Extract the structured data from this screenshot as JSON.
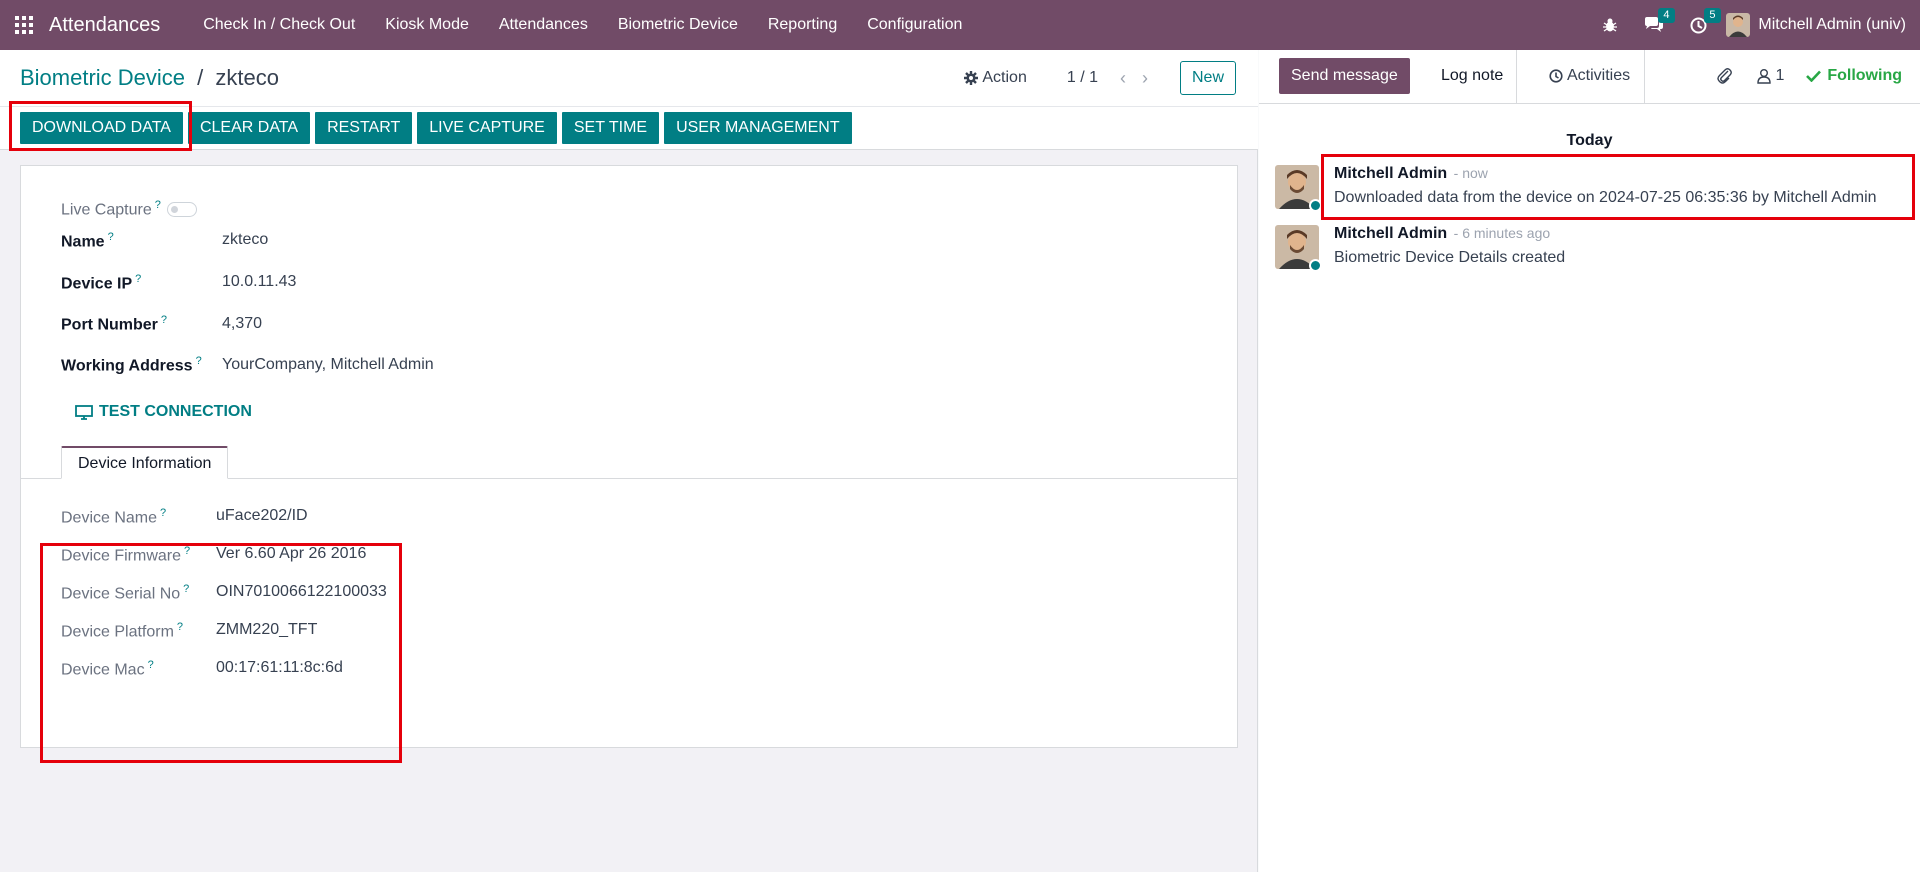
{
  "navbar": {
    "app_name": "Attendances",
    "menu": [
      "Check In / Check Out",
      "Kiosk Mode",
      "Attendances",
      "Biometric Device",
      "Reporting",
      "Configuration"
    ],
    "messages_count": "4",
    "activities_count": "5",
    "user": "Mitchell Admin (univ)",
    "icons": [
      "apps-grid-icon",
      "bug-icon",
      "chat-icon",
      "clock-icon"
    ]
  },
  "breadcrumb": {
    "parent": "Biometric Device",
    "separator": "/",
    "current": "zkteco"
  },
  "control": {
    "action": "Action",
    "pager": "1 / 1",
    "new": "New"
  },
  "header_buttons": [
    "DOWNLOAD DATA",
    "CLEAR DATA",
    "RESTART",
    "LIVE CAPTURE",
    "SET TIME",
    "USER MANAGEMENT"
  ],
  "form": {
    "live_capture_label": "Live Capture",
    "live_capture_on": false,
    "help_mark": "?",
    "name_label": "Name",
    "name": "zkteco",
    "ip_label": "Device IP",
    "ip": "10.0.11.43",
    "port_label": "Port Number",
    "port": "4,370",
    "address_label": "Working Address",
    "address": "YourCompany, Mitchell Admin",
    "test_connection": "TEST CONNECTION",
    "tab": "Device Information",
    "device": [
      {
        "label": "Device Name",
        "value": "uFace202/ID"
      },
      {
        "label": "Device Firmware",
        "value": "Ver 6.60 Apr 26 2016"
      },
      {
        "label": "Device Serial No",
        "value": "OIN7010066122100033"
      },
      {
        "label": "Device Platform",
        "value": "ZMM220_TFT"
      },
      {
        "label": "Device Mac",
        "value": "00:17:61:11:8c:6d"
      }
    ]
  },
  "chatter": {
    "send_message": "Send message",
    "log_note": "Log note",
    "activities": "Activities",
    "followers": "1",
    "following": "Following",
    "day": "Today",
    "messages": [
      {
        "author": "Mitchell Admin",
        "time": "- now",
        "body": "Downloaded data from the device on 2024-07-25 06:35:36 by Mitchell Admin"
      },
      {
        "author": "Mitchell Admin",
        "time": "- 6 minutes ago",
        "body": "Biometric Device Details created"
      }
    ]
  },
  "colors": {
    "brand": "#714b67",
    "accent": "#017e84",
    "highlight": "#e5000b",
    "following": "#28a745"
  }
}
